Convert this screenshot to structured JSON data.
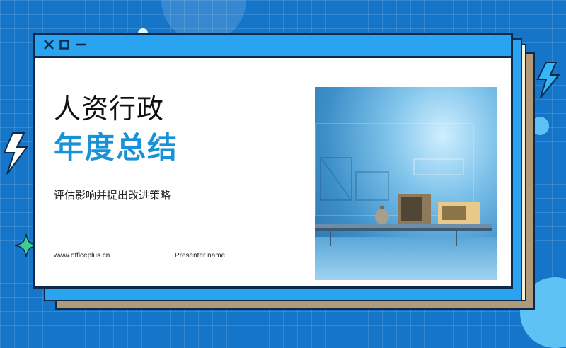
{
  "slide": {
    "title_line1": "人资行政",
    "title_line2": "年度总结",
    "subtitle": "评估影响并提出改进策略",
    "website": "www.officeplus.cn",
    "presenter": "Presenter  name"
  },
  "window": {
    "controls": [
      "close-icon",
      "restore-icon",
      "minimize-icon"
    ]
  },
  "colors": {
    "background": "#1575c9",
    "title_bar": "#2aa4f0",
    "accent_title": "#1792d6",
    "back_layer_tan": "#b09a7a",
    "back_layer_cream": "#f4f0d8",
    "outline": "#0c2a4a"
  }
}
